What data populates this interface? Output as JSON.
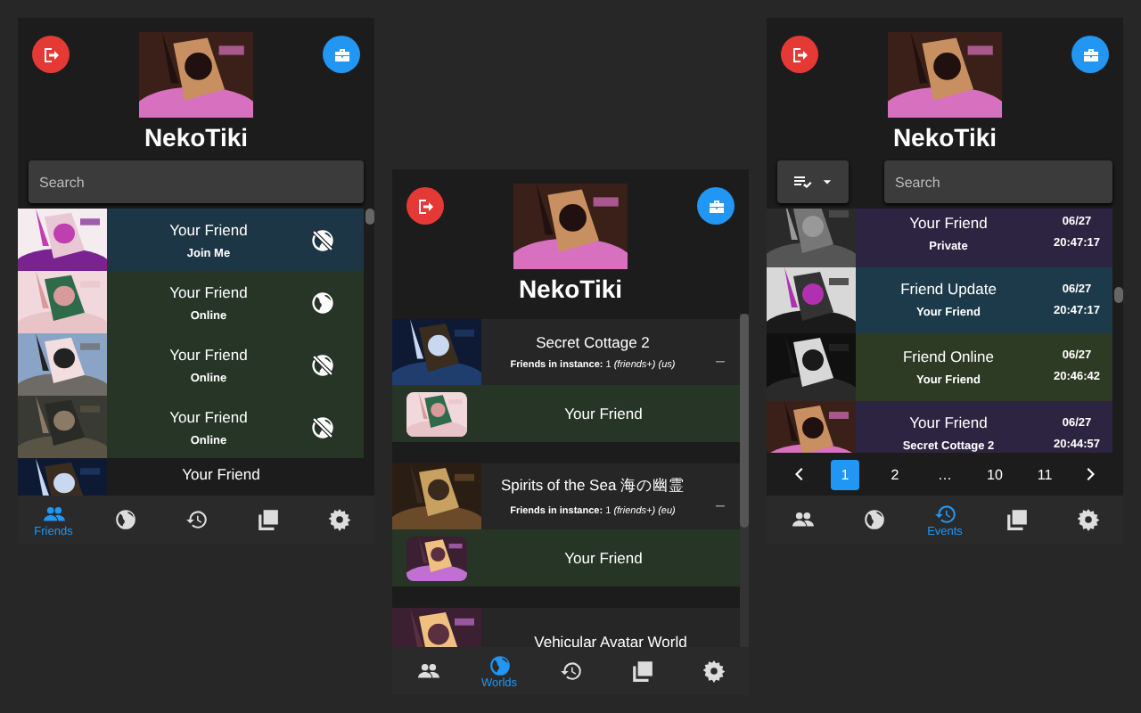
{
  "panels": [
    {
      "kind": "friends",
      "user": {
        "name": "NekoTiki"
      },
      "search": {
        "placeholder": "Search"
      },
      "friends": [
        {
          "name": "Your Friend",
          "status": "Join Me",
          "color": "#1d3645",
          "kind": "private"
        },
        {
          "name": "Your Friend",
          "status": "Online",
          "color": "#263526",
          "kind": "public"
        },
        {
          "name": "Your Friend",
          "status": "Online",
          "color": "#263526",
          "kind": "private"
        },
        {
          "name": "Your Friend",
          "status": "Online",
          "color": "#263526",
          "kind": "private"
        },
        {
          "name": "Your Friend"
        }
      ],
      "nav": [
        {
          "kind": "friends",
          "label": "Friends",
          "selected": true
        },
        {
          "kind": "worlds",
          "selected": false
        },
        {
          "kind": "events",
          "selected": false
        },
        {
          "kind": "gallery",
          "selected": false
        },
        {
          "kind": "settings",
          "selected": false
        }
      ]
    },
    {
      "kind": "worlds",
      "user": {
        "name": "NekoTiki"
      },
      "worlds": [
        {
          "name": "Secret Cottage 2",
          "instance": "**Friends in instance:** 1 *(friends+) (us)*",
          "friends": [
            {
              "name": "Your Friend"
            }
          ]
        },
        {
          "name": "Spirits of the Sea 海の幽霊",
          "instance": "**Friends in instance:** 1 *(friends+) (eu)*",
          "friends": [
            {
              "name": "Your Friend"
            }
          ]
        },
        {
          "name": "Vehicular Avatar World"
        }
      ],
      "nav": [
        {
          "kind": "friends",
          "selected": false
        },
        {
          "kind": "worlds",
          "label": "Worlds",
          "selected": true
        },
        {
          "kind": "events",
          "selected": false
        },
        {
          "kind": "gallery",
          "selected": false
        },
        {
          "kind": "settings",
          "selected": false
        }
      ]
    },
    {
      "kind": "events",
      "user": {
        "name": "NekoTiki"
      },
      "search": {
        "placeholder": "Search"
      },
      "events": [
        {
          "title": "Your Friend",
          "subtitle": "Private",
          "date": "06/27",
          "time": "20:47:17",
          "color": "#2c2440"
        },
        {
          "title": "Friend Update",
          "subtitle": "Your Friend",
          "date": "06/27",
          "time": "20:47:17",
          "color": "#1d3a4a"
        },
        {
          "title": "Friend Online",
          "subtitle": "Your Friend",
          "date": "06/27",
          "time": "20:46:42",
          "color": "#2d3a24"
        },
        {
          "title": "Your Friend",
          "subtitle": "Secret Cottage 2",
          "date": "06/27",
          "time": "20:44:57",
          "color": "#2c2440"
        }
      ],
      "pages": [
        {
          "label": "1",
          "selected": true
        },
        {
          "label": "2",
          "selected": false
        },
        {
          "label": "…",
          "selected": false
        },
        {
          "label": "10",
          "selected": false
        },
        {
          "label": "11",
          "selected": false
        }
      ],
      "nav": [
        {
          "kind": "friends",
          "selected": false
        },
        {
          "kind": "worlds",
          "selected": false
        },
        {
          "kind": "events",
          "label": "Events",
          "selected": true
        },
        {
          "kind": "gallery",
          "selected": false
        },
        {
          "kind": "settings",
          "selected": false
        }
      ]
    }
  ]
}
